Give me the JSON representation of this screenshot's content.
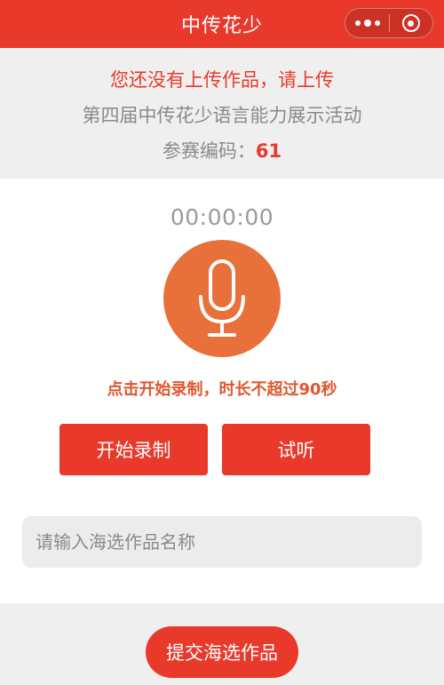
{
  "navbar": {
    "title": "中传花少",
    "more_icon": "more-dots-icon",
    "close_icon": "target-close-icon",
    "color": "#e8392b"
  },
  "info": {
    "warning": "您还没有上传作品，请上传",
    "event_name": "第四届中传花少语言能力展示活动",
    "code_label": "参赛编码：",
    "code_value": "61"
  },
  "recorder": {
    "timer": "00:00:00",
    "mic_icon": "microphone-icon",
    "hint": "点击开始录制，时长不超过90秒",
    "start_label": "开始录制",
    "listen_label": "试听"
  },
  "form": {
    "name_placeholder": "请输入海选作品名称",
    "name_value": ""
  },
  "footer": {
    "submit_label": "提交海选作品"
  }
}
